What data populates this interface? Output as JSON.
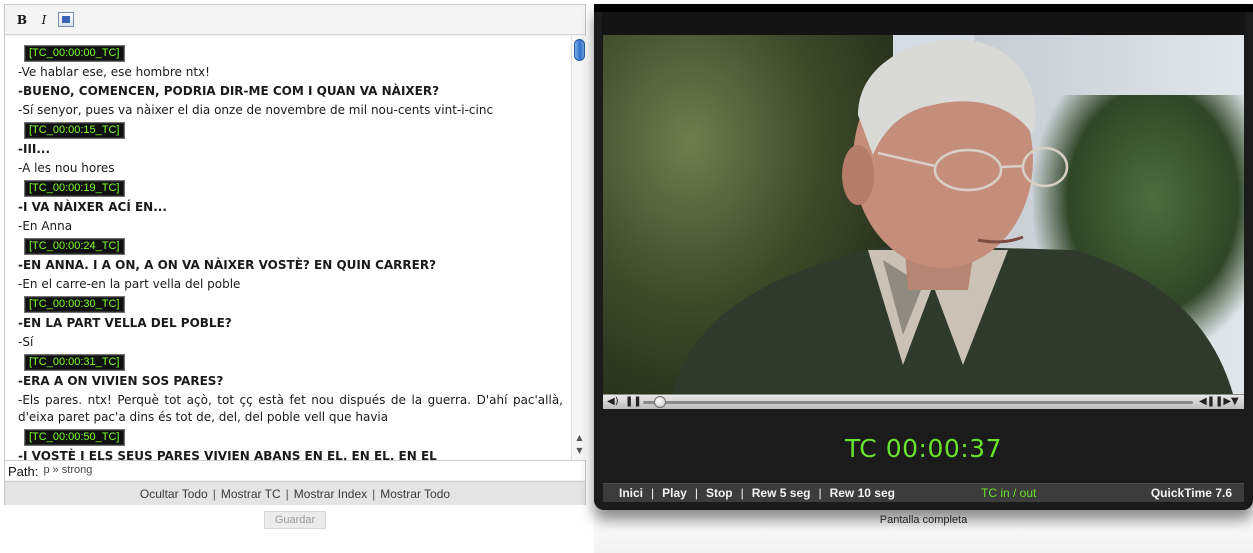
{
  "toolbar": {
    "bold_label": "B",
    "italic_label": "I"
  },
  "transcript": [
    {
      "type": "tc",
      "text": "[TC_00:00:00_TC]"
    },
    {
      "type": "line",
      "text": "-Ve hablar ese, ese hombre ntx!"
    },
    {
      "type": "bold",
      "text": "-BUENO, COMENCEN, PODRIA DIR-ME COM I QUAN VA NÀIXER?"
    },
    {
      "type": "line",
      "text": "-Sí senyor, pues va nàixer el dia onze de novembre de mil nou-cents vint-i-cinc"
    },
    {
      "type": "tc",
      "text": "[TC_00:00:15_TC]"
    },
    {
      "type": "bold",
      "text": "-III..."
    },
    {
      "type": "line",
      "text": "-A les nou hores"
    },
    {
      "type": "tc",
      "text": "[TC_00:00:19_TC]"
    },
    {
      "type": "bold",
      "text": "-I VA NÀIXER ACÍ EN..."
    },
    {
      "type": "line",
      "text": "-En Anna"
    },
    {
      "type": "tc",
      "text": "[TC_00:00:24_TC]"
    },
    {
      "type": "bold",
      "text": "-EN ANNA. I A ON, A ON VA NÀIXER VOSTÈ? EN QUIN CARRER?"
    },
    {
      "type": "line",
      "text": "-En el carre-en la part vella del poble"
    },
    {
      "type": "tc",
      "text": "[TC_00:00:30_TC]"
    },
    {
      "type": "bold",
      "text": "-EN LA PART VELLA DEL POBLE?"
    },
    {
      "type": "line",
      "text": "-Sí"
    },
    {
      "type": "tc",
      "text": "[TC_00:00:31_TC]"
    },
    {
      "type": "bold",
      "text": "-ERA A ON VIVIEN SOS PARES?"
    },
    {
      "type": "wrap",
      "text": "-Els pares. ntx! Perquè tot açò, tot çç està fet nou dispués de la guerra. D'ahí pac'allà, d'eixa paret pac'a dins és tot de, del, del poble vell que havia"
    },
    {
      "type": "tc",
      "text": "[TC_00:00:50_TC]"
    },
    {
      "type": "bold",
      "text": "-I VOSTÈ I ELS SEUS PARES VIVIEN ABANS EN EL, EN EL, EN EL"
    }
  ],
  "path": {
    "label": "Path:",
    "value": "p » strong"
  },
  "view_links": [
    "Ocultar Todo",
    "Mostrar TC",
    "Mostrar Index",
    "Mostrar Todo"
  ],
  "save_label": "Guardar",
  "player": {
    "timecode": "TC 00:00:37",
    "controls": [
      "Inici",
      "Play",
      "Stop",
      "Rew 5 seg",
      "Rew 10 seg"
    ],
    "tc_in_out": "TC in / out",
    "quicktime": "QuickTime 7.6",
    "progress_fraction": 0.02
  },
  "fullscreen_label": "Pantalla completa",
  "colors": {
    "timecode_green": "#69e22c",
    "tc_tag_green": "#7cff2a",
    "player_bg": "#1b1b1b"
  },
  "icons": {
    "word": "word-icon",
    "volume": "volume-icon",
    "pause": "pause-icon",
    "step": "step-icon",
    "menu": "menu-triangle-icon"
  }
}
